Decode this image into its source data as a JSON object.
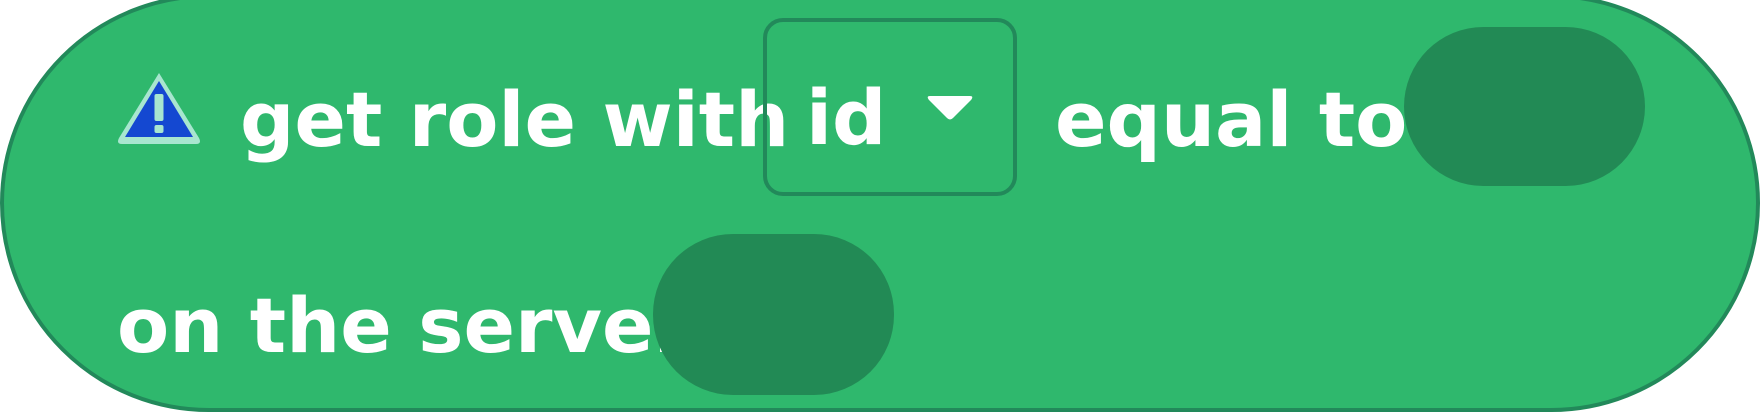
{
  "block": {
    "warning_icon": "warning-triangle-icon",
    "label_get_role_with": "get role with",
    "dropdown": {
      "selected": "id",
      "arrow_icon": "chevron-down-icon"
    },
    "label_equal_to": "equal to",
    "value_input": "",
    "label_on_the_server": "on the server",
    "server_input": ""
  },
  "colors": {
    "block_fill": "#2fb86d",
    "block_border": "#22895a",
    "input_slot": "#228a55",
    "warning_fill": "#1448d1",
    "warning_outline": "#a8e6cf"
  }
}
